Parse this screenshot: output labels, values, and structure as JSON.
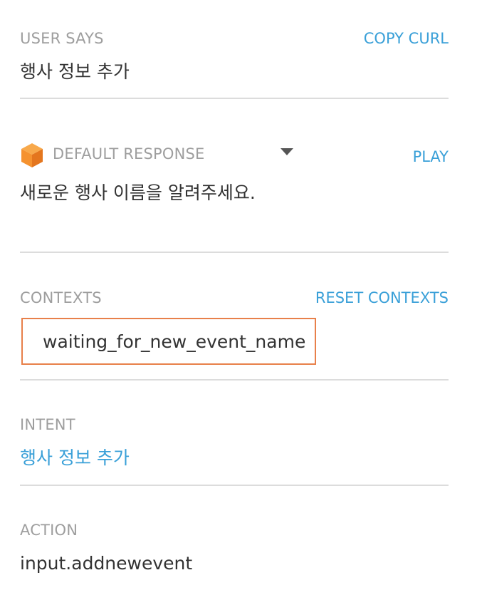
{
  "user_says": {
    "label": "USER SAYS",
    "copy_curl": "COPY CURL",
    "value": "행사 정보 추가"
  },
  "default_response": {
    "icon": "cube-icon",
    "label": "DEFAULT RESPONSE",
    "play": "PLAY",
    "value": "새로운 행사 이름을 알려주세요."
  },
  "contexts": {
    "label": "CONTEXTS",
    "reset": "RESET CONTEXTS",
    "items": [
      "waiting_for_new_event_name"
    ]
  },
  "intent": {
    "label": "INTENT",
    "value": "행사 정보 추가"
  },
  "action": {
    "label": "ACTION",
    "value": "input.addnewevent"
  },
  "colors": {
    "accent": "#3aa0d8",
    "context_border": "#e8804a",
    "cube": "#f5922f"
  }
}
